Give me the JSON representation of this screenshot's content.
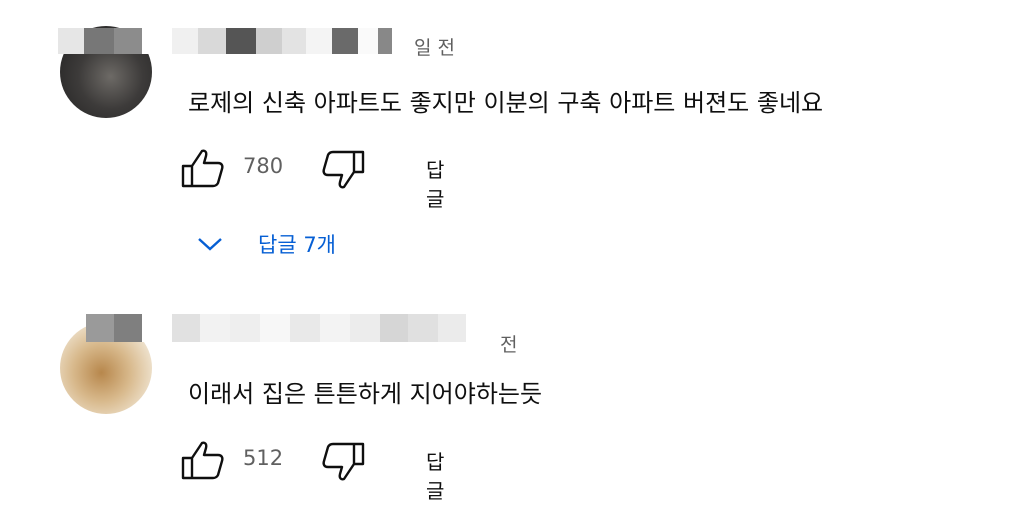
{
  "comments": [
    {
      "time_suffix": "일 전",
      "text": "로제의 신축 아파트도 좋지만 이분의 구축 아파트 버젼도 좋네요",
      "like_count": "780",
      "reply_label": "답글",
      "replies_toggle_label": "답글 7개"
    },
    {
      "time_suffix": "전",
      "text": "이래서 집은 튼튼하게 지어야하는듯",
      "like_count": "512",
      "reply_label": "답글"
    }
  ],
  "icons": {
    "like": "thumbs-up-icon",
    "dislike": "thumbs-down-icon",
    "expand": "chevron-down-icon"
  },
  "colors": {
    "link_blue": "#065fd4",
    "meta_gray": "#606060",
    "text": "#0f0f0f"
  }
}
